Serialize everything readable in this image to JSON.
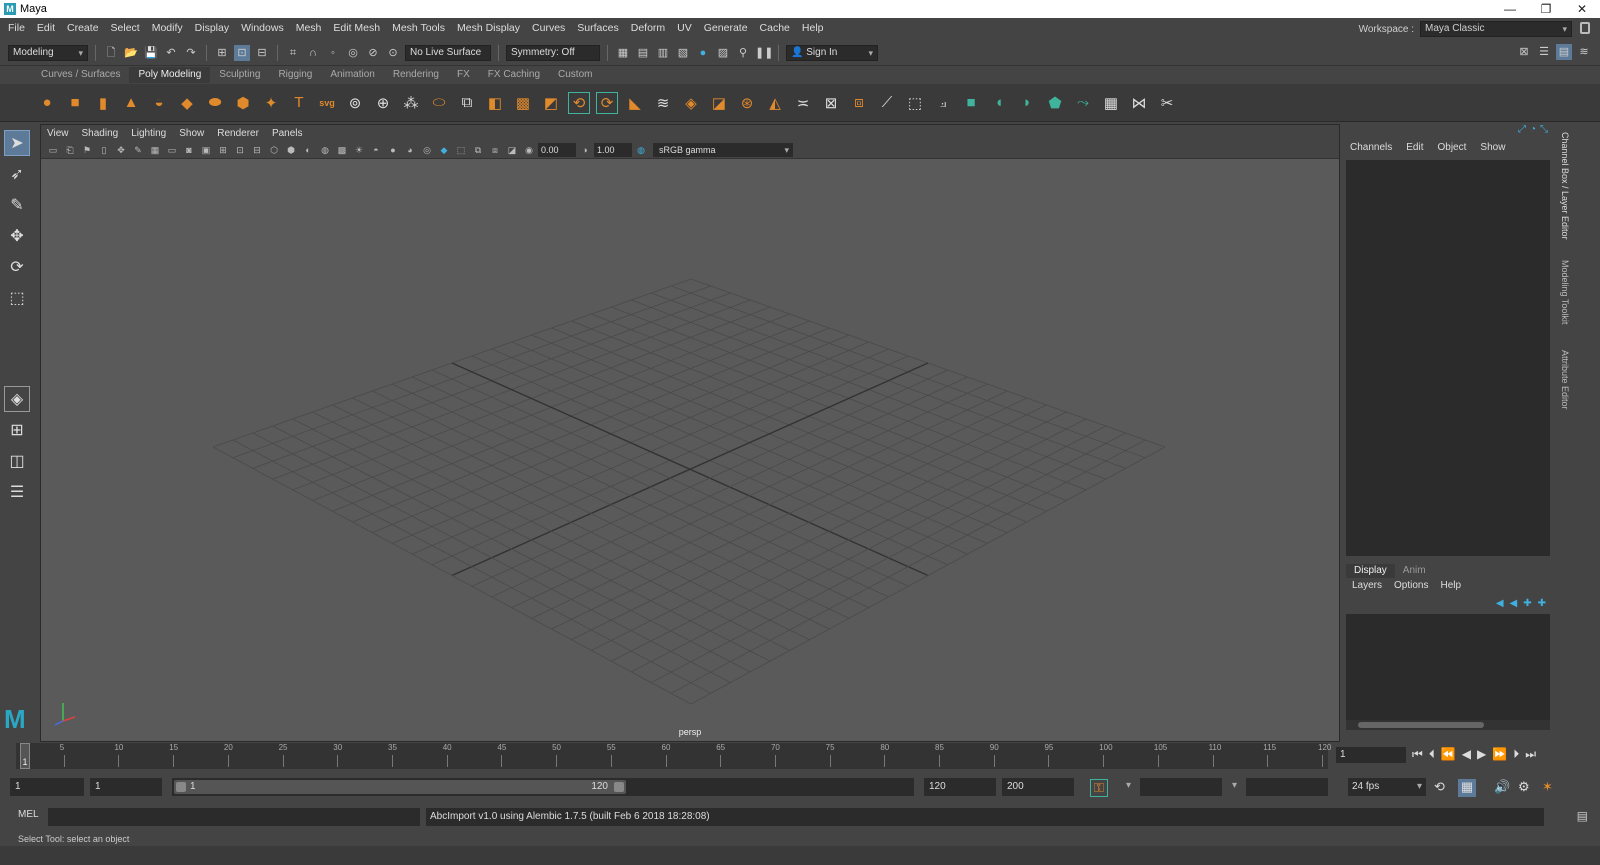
{
  "window": {
    "title": "Maya",
    "app_icon": "M"
  },
  "menu": [
    "File",
    "Edit",
    "Create",
    "Select",
    "Modify",
    "Display",
    "Windows",
    "Mesh",
    "Edit Mesh",
    "Mesh Tools",
    "Mesh Display",
    "Curves",
    "Surfaces",
    "Deform",
    "UV",
    "Generate",
    "Cache",
    "Help"
  ],
  "workspace": {
    "label": "Workspace :",
    "value": "Maya Classic"
  },
  "status_line": {
    "mode": "Modeling",
    "live_surface": "No Live Surface",
    "symmetry": "Symmetry: Off",
    "sign_in": "Sign In"
  },
  "shelf": {
    "tabs": [
      "Curves / Surfaces",
      "Poly Modeling",
      "Sculpting",
      "Rigging",
      "Animation",
      "Rendering",
      "FX",
      "FX Caching",
      "Custom"
    ],
    "active_tab": 1
  },
  "viewport": {
    "menu": [
      "View",
      "Shading",
      "Lighting",
      "Show",
      "Renderer",
      "Panels"
    ],
    "exposure": "0.00",
    "gamma_value": "1.00",
    "color_space": "sRGB gamma",
    "camera": "persp"
  },
  "channel_box": {
    "menu": [
      "Channels",
      "Edit",
      "Object",
      "Show"
    ]
  },
  "layer_editor": {
    "tabs": [
      "Display",
      "Anim"
    ],
    "menu": [
      "Layers",
      "Options",
      "Help"
    ]
  },
  "side_tabs": [
    "Channel Box / Layer Editor",
    "Modeling Toolkit",
    "Attribute Editor"
  ],
  "time_slider": {
    "ticks": [
      "5",
      "10",
      "15",
      "20",
      "25",
      "30",
      "35",
      "40",
      "45",
      "50",
      "55",
      "60",
      "65",
      "70",
      "75",
      "80",
      "85",
      "90",
      "95",
      "100",
      "105",
      "110",
      "115",
      "120"
    ],
    "current_frame_marker": "1",
    "current_frame": "1"
  },
  "range_slider": {
    "start": "1",
    "anim_start": "1",
    "range_start": "1",
    "range_end": "120",
    "playback_end": "120",
    "anim_end": "200",
    "fps": "24 fps"
  },
  "command_line": {
    "label": "MEL",
    "output": "AbcImport v1.0 using Alembic 1.7.5 (built Feb  6 2018 18:28:08)"
  },
  "help_line": "Select Tool: select an object",
  "colors": {
    "accent_orange": "#e08a2c",
    "accent_teal": "#3fb39b",
    "accent_blue": "#2aa7c4"
  }
}
